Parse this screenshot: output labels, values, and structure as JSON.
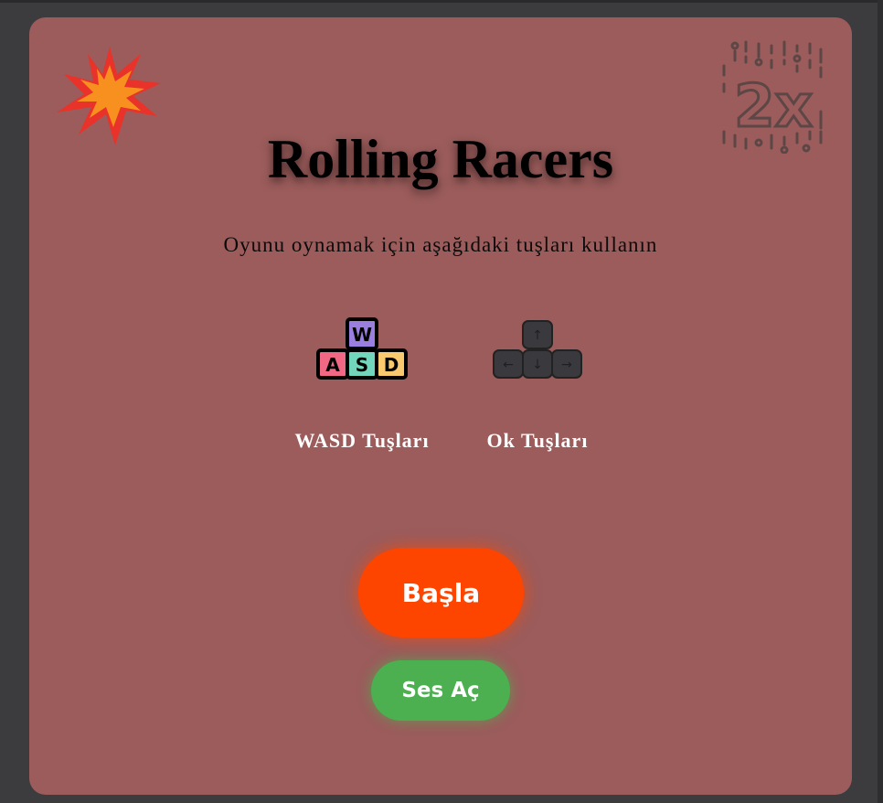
{
  "game": {
    "title": "Rolling Racers",
    "instructions": "Oyunu oynamak için aşağıdaki tuşları kullanın"
  },
  "controls": [
    {
      "label": "WASD Tuşları",
      "icon": "wasd-keys-icon",
      "keys": [
        "W",
        "A",
        "S",
        "D"
      ]
    },
    {
      "label": "Ok Tuşları",
      "icon": "arrow-keys-icon",
      "keys": [
        "↑",
        "←",
        "↓",
        "→"
      ]
    }
  ],
  "buttons": {
    "start_label": "Başla",
    "sound_label": "Ses Aç"
  },
  "badges": {
    "speed_text": "2x",
    "burst_icon": "explosion-icon"
  },
  "colors": {
    "panel": "#9b5c5b",
    "start": "#fe4500",
    "sound": "#4caf50",
    "key_w": "#9b7fe0",
    "key_a": "#f06883",
    "key_s": "#72d6bd",
    "key_d": "#f8c96e"
  }
}
